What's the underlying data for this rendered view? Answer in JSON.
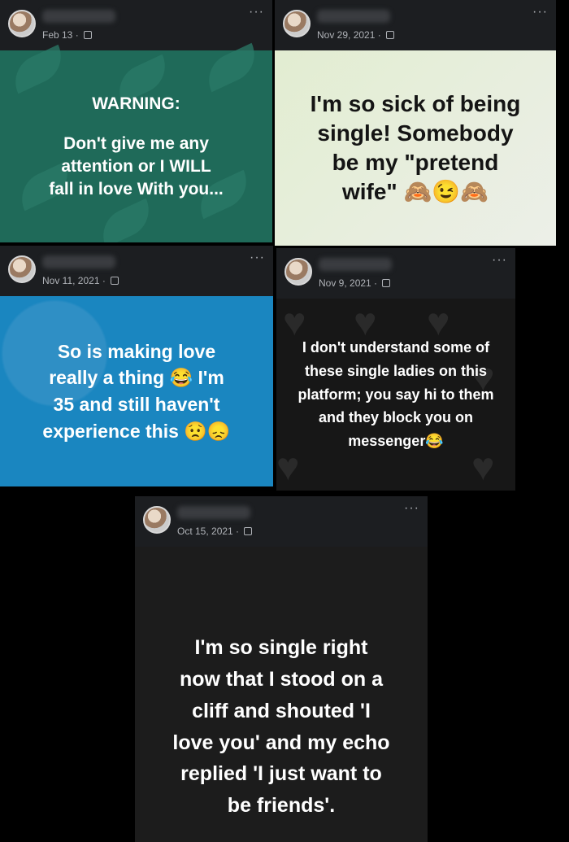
{
  "posts": [
    {
      "date": "Feb 13 · ",
      "text_lines": [
        "WARNING:",
        "Don't give me any",
        "attention or I WILL",
        "fall in love With you..."
      ],
      "background": "#1f6a59"
    },
    {
      "date": "Nov 29, 2021 · ",
      "text_lines": [
        "I'm so sick of being",
        "single! Somebody",
        "be my \"pretend",
        "wife\" 🙈😉🙈"
      ],
      "background": "#e2edd1"
    },
    {
      "date": "Nov 11, 2021 · ",
      "text_lines": [
        "So is making love",
        "really a thing 😂 I'm",
        "35 and still haven't",
        "experience this 😟😞"
      ],
      "background": "#1a86c0"
    },
    {
      "date": "Nov 9, 2021 · ",
      "text_lines": [
        "I don't understand some of",
        "these single ladies on this",
        "platform; you say hi to them",
        "and they block you on",
        "messenger😂"
      ],
      "background": "#171717"
    },
    {
      "date": "Oct 15, 2021 · ",
      "text_lines": [
        "I'm so single right",
        "now that I stood on a",
        "cliff and shouted 'I",
        "love you' and my echo",
        "replied 'I just want to",
        "be friends'."
      ],
      "background": "#1c1c1c"
    }
  ],
  "more_menu_label": "···"
}
